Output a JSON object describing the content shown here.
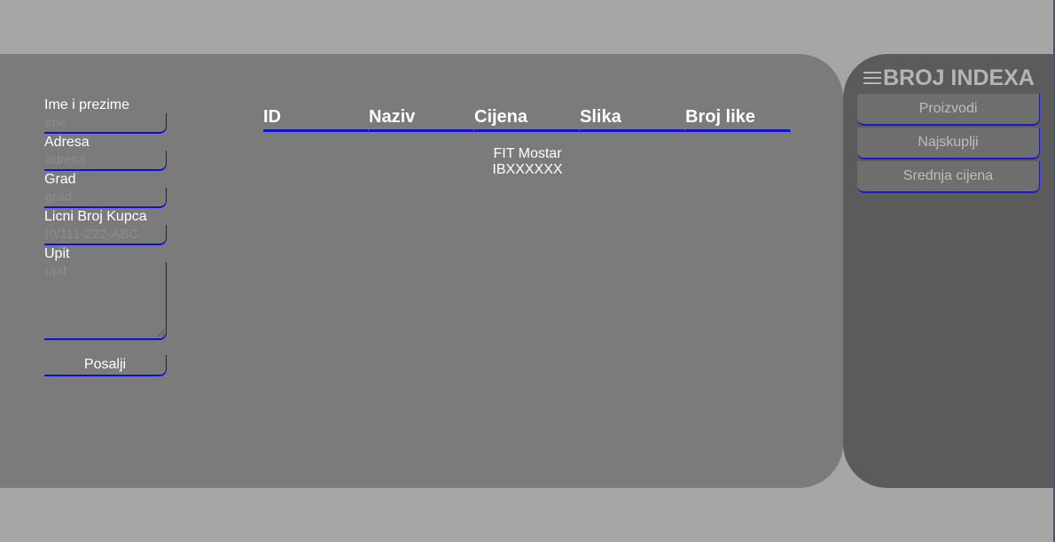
{
  "form": {
    "fields": [
      {
        "label": "Ime i prezime",
        "placeholder": "ime"
      },
      {
        "label": "Adresa",
        "placeholder": "adresa"
      },
      {
        "label": "Grad",
        "placeholder": "grad"
      },
      {
        "label": "Licni Broj Kupca",
        "placeholder": "I0/111-222-ABC"
      }
    ],
    "query": {
      "label": "Upit",
      "placeholder": "upit"
    },
    "submit_label": "Posalji"
  },
  "table": {
    "headers": [
      "ID",
      "Naziv",
      "Cijena",
      "Slika",
      "Broj like"
    ]
  },
  "footer": {
    "line1": "FIT Mostar",
    "line2": "IBXXXXXX"
  },
  "sidebar": {
    "title": "BROJ INDEXA",
    "menu_icon": "hamburger-menu-icon",
    "items": [
      {
        "label": "Proizvodi"
      },
      {
        "label": "Najskuplji"
      },
      {
        "label": "Srednja cijena"
      }
    ]
  },
  "colors": {
    "background": "#a6a6a6",
    "main_panel": "#7b7b7b",
    "side_panel": "#5b5b5b",
    "accent": "#0f0fd6"
  }
}
